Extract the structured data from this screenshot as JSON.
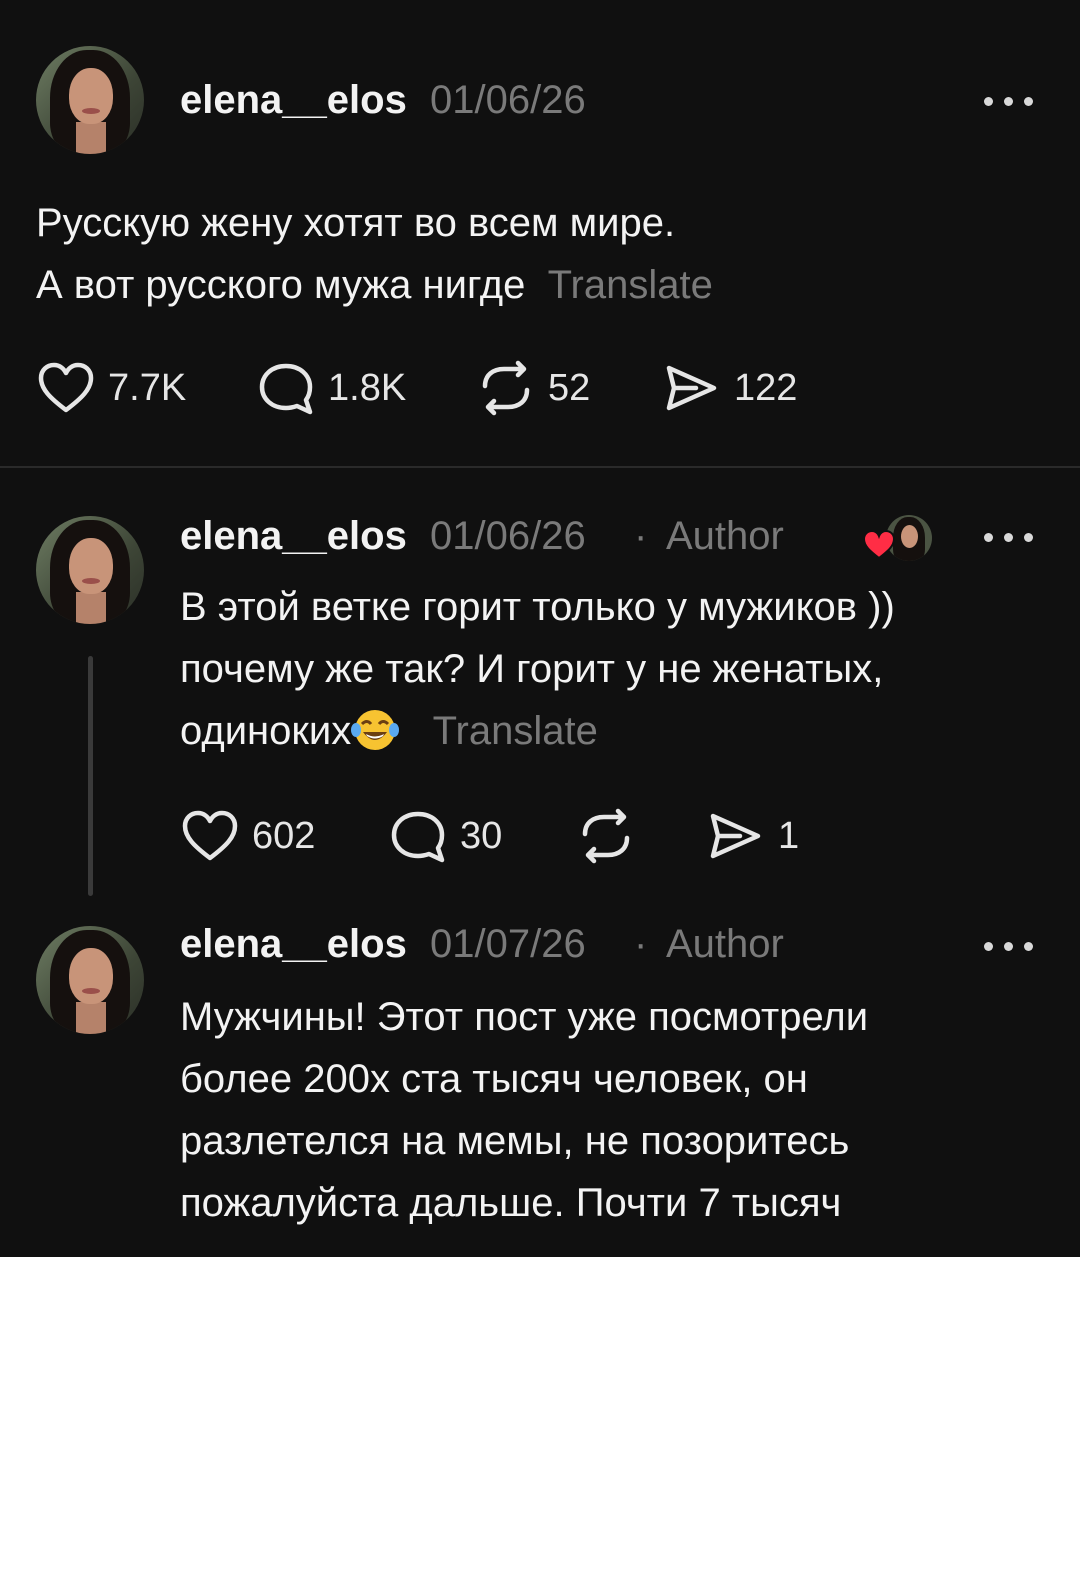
{
  "colors": {
    "background": "#101010",
    "text": "#f3f3f3",
    "muted": "#7a7a7a",
    "like_red": "#ff2d45"
  },
  "posts": [
    {
      "username": "elena__elos",
      "date": "01/06/26",
      "text_lines": [
        "Русскую жену хотят во всем мире.",
        "А вот русского мужа нигде"
      ],
      "translate": "Translate",
      "likes": "7.7K",
      "replies": "1.8K",
      "reposts": "52",
      "shares": "122"
    },
    {
      "username": "elena__elos",
      "date": "01/06/26",
      "dot": "·",
      "badge": "Author",
      "text_lines": [
        "В этой ветке горит только у мужиков ))",
        "почему же так? И горит у не женатых,",
        "одиноких"
      ],
      "emoji": "face-with-tears-of-joy",
      "translate": "Translate",
      "likes": "602",
      "replies": "30",
      "shares": "1"
    },
    {
      "username": "elena__elos",
      "date": "01/07/26",
      "dot": "·",
      "badge": "Author",
      "text_lines": [
        "Мужчины! Этот пост уже посмотрели",
        "более 200х ста тысяч человек, он",
        "разлетелся на мемы, не позоритесь",
        "пожалуйста дальше. Почти 7 тысяч"
      ]
    }
  ],
  "icons": [
    "heart-icon",
    "comment-icon",
    "repost-icon",
    "share-icon",
    "more-icon",
    "avatar"
  ]
}
